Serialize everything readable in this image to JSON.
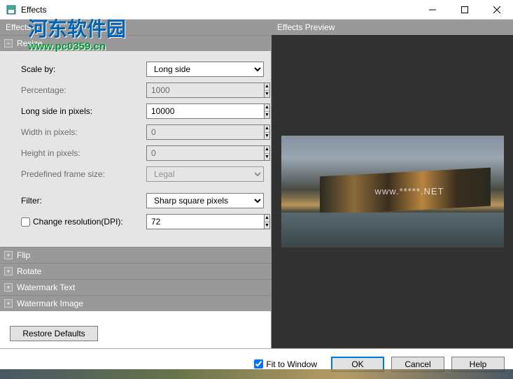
{
  "window": {
    "title": "Effects"
  },
  "watermark": {
    "text": "河东软件园",
    "url": "www.pc0359.cn"
  },
  "panel": {
    "left_title": "Effects",
    "right_title": "Effects Preview"
  },
  "groups": {
    "resize": "Resize",
    "flip": "Flip",
    "rotate": "Rotate",
    "watermark_text": "Watermark Text",
    "watermark_image": "Watermark Image"
  },
  "resize": {
    "scale_by_label": "Scale by:",
    "scale_by_value": "Long side",
    "percentage_label": "Percentage:",
    "percentage_value": "1000",
    "long_side_label": "Long side in pixels:",
    "long_side_value": "10000",
    "width_label": "Width in pixels:",
    "width_value": "0",
    "height_label": "Height in pixels:",
    "height_value": "0",
    "predefined_label": "Predefined frame size:",
    "predefined_value": "Legal",
    "filter_label": "Filter:",
    "filter_value": "Sharp square pixels",
    "dpi_label": "Change resolution(DPI):",
    "dpi_value": "72"
  },
  "preview_watermark": "www.*****.NET",
  "footer": {
    "restore": "Restore Defaults",
    "fit": "Fit to Window",
    "ok": "OK",
    "cancel": "Cancel",
    "help": "Help"
  }
}
